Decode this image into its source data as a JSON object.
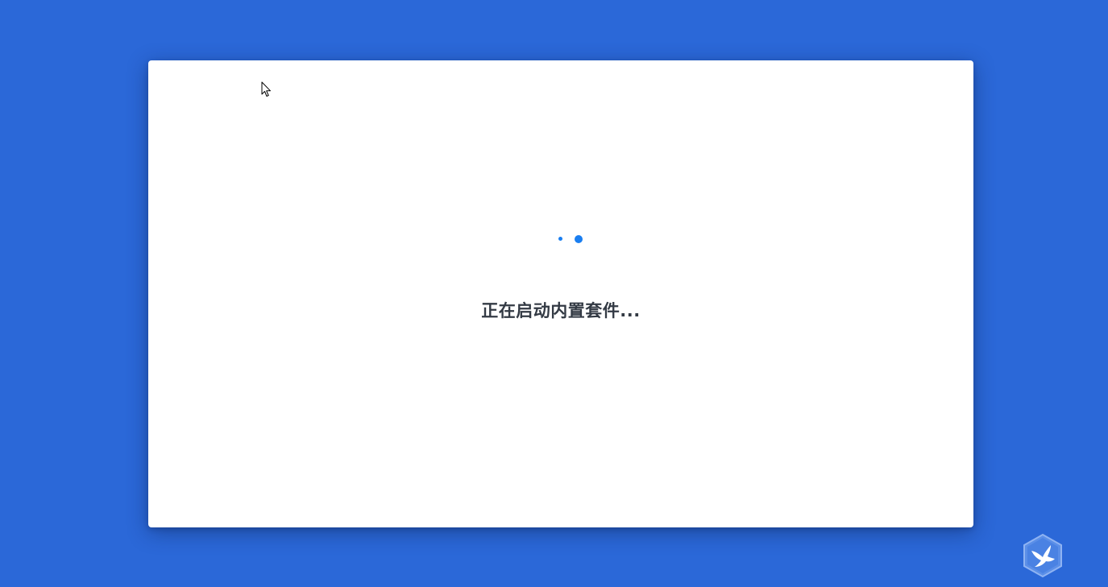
{
  "loader": {
    "status_text": "正在启动内置套件..."
  },
  "icons": {
    "spinner": "loading-dots-icon",
    "cursor": "mouse-pointer-icon",
    "logo": "bird-hexagon-logo-icon"
  },
  "colors": {
    "background": "#2b68d8",
    "dialog": "#ffffff",
    "spinner": "#1a7ef0",
    "text": "#333a44",
    "logo": "#5b8fe8"
  }
}
